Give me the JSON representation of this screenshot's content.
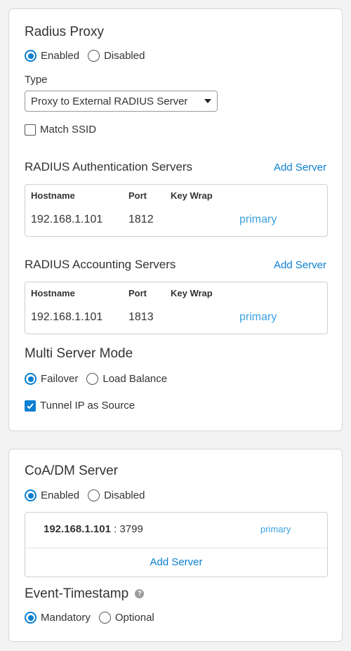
{
  "radius_proxy": {
    "title": "Radius Proxy",
    "state_options": {
      "enabled": "Enabled",
      "disabled": "Disabled",
      "selected": "enabled"
    },
    "type_label": "Type",
    "type_value": "Proxy to External RADIUS Server",
    "match_ssid": {
      "label": "Match SSID",
      "checked": false
    },
    "auth_servers": {
      "title": "RADIUS Authentication Servers",
      "add_label": "Add Server",
      "columns": [
        "Hostname",
        "Port",
        "Key Wrap"
      ],
      "rows": [
        {
          "hostname": "192.168.1.101",
          "port": "1812",
          "key_wrap": "",
          "role": "primary"
        }
      ]
    },
    "acct_servers": {
      "title": "RADIUS Accounting Servers",
      "add_label": "Add Server",
      "columns": [
        "Hostname",
        "Port",
        "Key Wrap"
      ],
      "rows": [
        {
          "hostname": "192.168.1.101",
          "port": "1813",
          "key_wrap": "",
          "role": "primary"
        }
      ]
    },
    "multi_server_mode": {
      "title": "Multi Server Mode",
      "options": {
        "failover": "Failover",
        "load_balance": "Load Balance",
        "selected": "failover"
      }
    },
    "tunnel_ip": {
      "label": "Tunnel IP as Source",
      "checked": true
    }
  },
  "coa_dm": {
    "title": "CoA/DM Server",
    "state_options": {
      "enabled": "Enabled",
      "disabled": "Disabled",
      "selected": "enabled"
    },
    "server": {
      "host": "192.168.1.101",
      "port_text": " : 3799",
      "role": "primary"
    },
    "add_label": "Add Server"
  },
  "event_timestamp": {
    "title": "Event-Timestamp",
    "help_glyph": "?",
    "options": {
      "mandatory": "Mandatory",
      "optional": "Optional",
      "selected": "mandatory"
    }
  },
  "colors": {
    "accent": "#0a7fd1",
    "primary_text": "#3ba0df",
    "card_border": "#d6d6d6"
  }
}
